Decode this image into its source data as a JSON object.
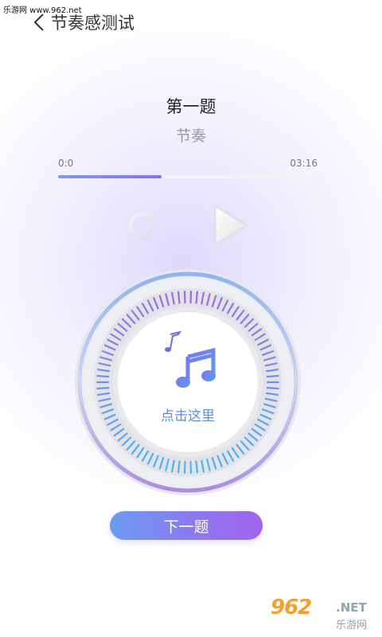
{
  "watermark_top": "乐游网 www.962.net",
  "header": {
    "title": "节奏感测试",
    "back_icon": "chevron-left-icon"
  },
  "question": {
    "title": "第一题",
    "subtitle": "节奏"
  },
  "player": {
    "time_start": "0:0",
    "time_end": "03:16",
    "progress": 0.4,
    "replay_icon": "replay-icon",
    "play_icon": "play-icon"
  },
  "dial": {
    "label": "点击这里",
    "icon": "music-notes-icon"
  },
  "next_button": {
    "label": "下一题"
  },
  "watermark_bottom": {
    "number": "962",
    "net": ".NET",
    "name": "乐游网"
  },
  "colors": {
    "accent_blue": "#6d9bf2",
    "accent_purple": "#a264ee",
    "label_blue": "#5a8fd8"
  }
}
